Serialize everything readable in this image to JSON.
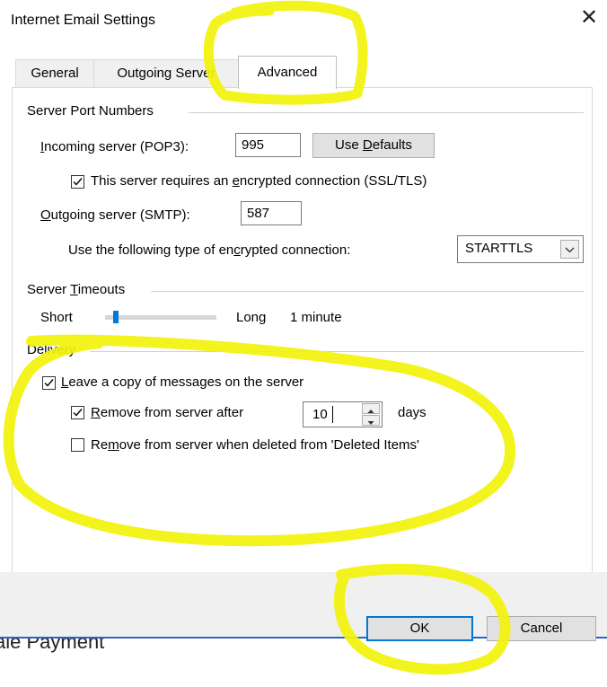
{
  "window": {
    "title": "Internet Email Settings",
    "close_glyph": "✕"
  },
  "tabs": [
    {
      "label": "General",
      "active": false
    },
    {
      "label": "Outgoing Server",
      "active": false
    },
    {
      "label": "Advanced",
      "active": true
    }
  ],
  "server_ports": {
    "group_label": "Server Port Numbers",
    "incoming_label_pre": "",
    "incoming_label_u": "I",
    "incoming_label_post": "ncoming server (POP3):",
    "incoming_value": "995",
    "use_defaults_pre": "Use ",
    "use_defaults_u": "D",
    "use_defaults_post": "efaults",
    "ssl_label_pre": "This server requires an ",
    "ssl_label_u": "e",
    "ssl_label_post": "ncrypted connection (SSL/TLS)",
    "ssl_checked": true,
    "outgoing_label_pre": "",
    "outgoing_label_u": "O",
    "outgoing_label_post": "utgoing server (SMTP):",
    "outgoing_value": "587",
    "enc_label_pre": "Use the following type of en",
    "enc_label_u": "c",
    "enc_label_post": "rypted connection:",
    "enc_value": "STARTTLS"
  },
  "timeouts": {
    "group_label_pre": "Server ",
    "group_label_u": "T",
    "group_label_post": "imeouts",
    "short_label": "Short",
    "long_label": "Long",
    "value_text": "1 minute",
    "level_fraction": 0.08
  },
  "delivery": {
    "group_label": "Delivery",
    "leave_copy_pre": "",
    "leave_copy_u": "L",
    "leave_copy_post": "eave a copy of messages on the server",
    "leave_copy_checked": true,
    "remove_after_pre": "",
    "remove_after_u": "R",
    "remove_after_post": "emove from server after",
    "remove_after_checked": true,
    "days_value": "10",
    "days_label": "days",
    "remove_deleted_pre": "Re",
    "remove_deleted_u": "m",
    "remove_deleted_post": "ove from server when deleted from 'Deleted Items'",
    "remove_deleted_checked": false
  },
  "buttons": {
    "ok": "OK",
    "cancel": "Cancel"
  },
  "background_fragment": "ale Payment",
  "colors": {
    "highlighter": "#f2f20a",
    "accent": "#0078d7",
    "dialog_bg": "#f0f0f0"
  }
}
